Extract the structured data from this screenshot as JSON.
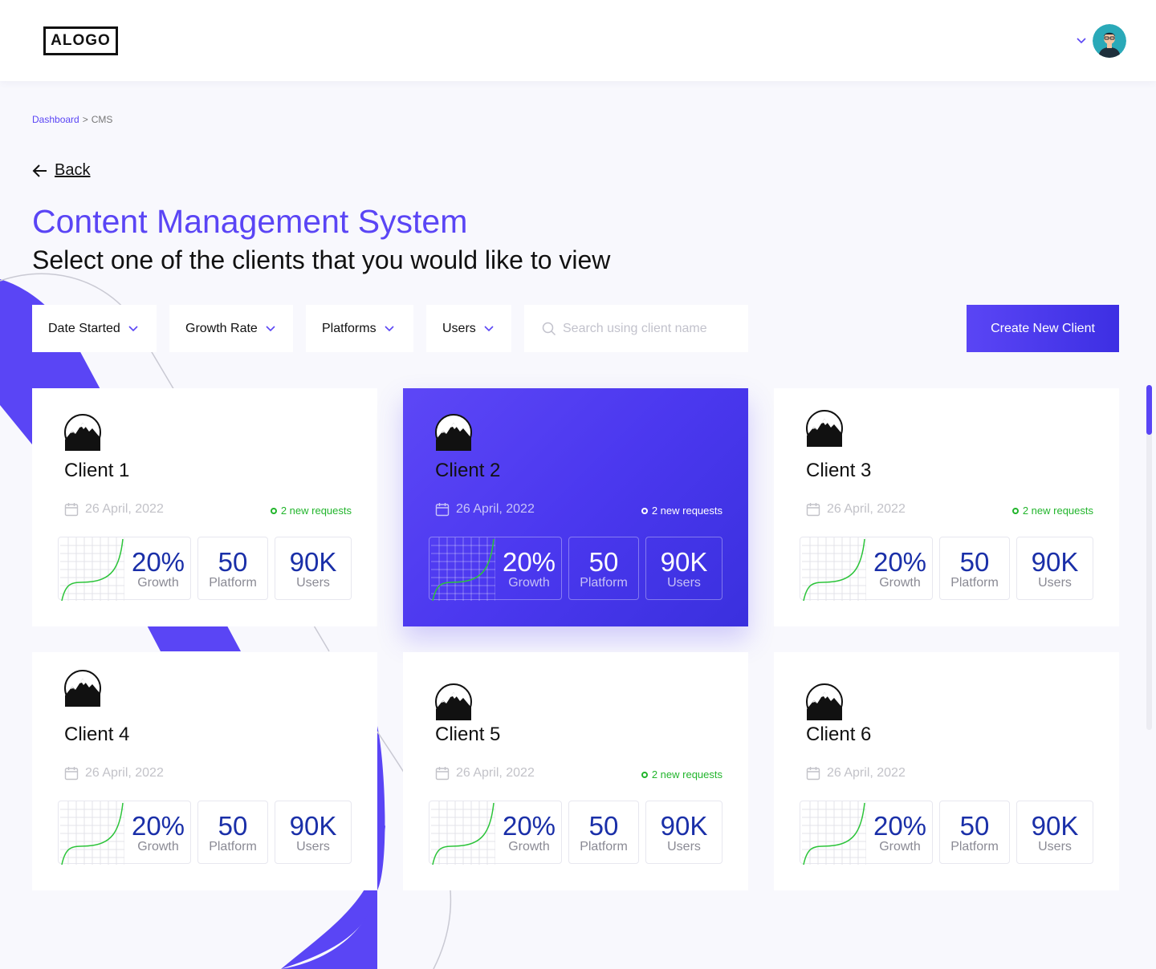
{
  "header": {
    "logo_text": "ALOGO",
    "user_avatar_icon": "user-avatar",
    "dropdown_icon": "chevron-down-icon"
  },
  "breadcrumb": {
    "items": [
      "Dashboard",
      "CMS"
    ],
    "separator": ">"
  },
  "back": {
    "label": "Back",
    "icon": "arrow-left-icon"
  },
  "page": {
    "title": "Content Management System",
    "subtitle": "Select one of the clients that you would like to view"
  },
  "filters": [
    {
      "label": "Date Started",
      "icon": "chevron-down-icon"
    },
    {
      "label": "Growth Rate",
      "icon": "chevron-down-icon"
    },
    {
      "label": "Platforms",
      "icon": "chevron-down-icon"
    },
    {
      "label": "Users",
      "icon": "chevron-down-icon"
    }
  ],
  "search": {
    "placeholder": "Search using client name",
    "value": "",
    "icon": "search-icon"
  },
  "create_button": {
    "label": "Create New Client"
  },
  "colors": {
    "accent": "#5a45f5",
    "accent_dark": "#3a30de",
    "stat_value": "#1a2fa8",
    "success": "#22b52c",
    "background": "#f8f8fd"
  },
  "clients": [
    {
      "name": "Client 1",
      "date": "26 April, 2022",
      "requests": "2 new requests",
      "growth": "20%",
      "growth_label": "Growth",
      "platform": "50",
      "platform_label": "Platform",
      "users": "90K",
      "users_label": "Users",
      "active": false,
      "icon": "mountain-icon",
      "date_icon": "calendar-icon"
    },
    {
      "name": "Client 2",
      "date": "26 April, 2022",
      "requests": "2 new requests",
      "growth": "20%",
      "growth_label": "Growth",
      "platform": "50",
      "platform_label": "Platform",
      "users": "90K",
      "users_label": "Users",
      "active": true,
      "icon": "mountain-icon",
      "date_icon": "calendar-icon"
    },
    {
      "name": "Client 3",
      "date": "26 April, 2022",
      "requests": "2 new requests",
      "growth": "20%",
      "growth_label": "Growth",
      "platform": "50",
      "platform_label": "Platform",
      "users": "90K",
      "users_label": "Users",
      "active": false,
      "icon": "mountain-icon",
      "date_icon": "calendar-icon"
    },
    {
      "name": "Client 4",
      "date": "26 April, 2022",
      "requests": "",
      "growth": "20%",
      "growth_label": "Growth",
      "platform": "50",
      "platform_label": "Platform",
      "users": "90K",
      "users_label": "Users",
      "active": false,
      "icon": "mountain-icon",
      "date_icon": "calendar-icon"
    },
    {
      "name": "Client 5",
      "date": "26 April, 2022",
      "requests": "2 new requests",
      "growth": "20%",
      "growth_label": "Growth",
      "platform": "50",
      "platform_label": "Platform",
      "users": "90K",
      "users_label": "Users",
      "active": false,
      "icon": "mountain-icon",
      "date_icon": "calendar-icon"
    },
    {
      "name": "Client 6",
      "date": "26 April, 2022",
      "requests": "",
      "growth": "20%",
      "growth_label": "Growth",
      "platform": "50",
      "platform_label": "Platform",
      "users": "90K",
      "users_label": "Users",
      "active": false,
      "icon": "mountain-icon",
      "date_icon": "calendar-icon"
    }
  ]
}
